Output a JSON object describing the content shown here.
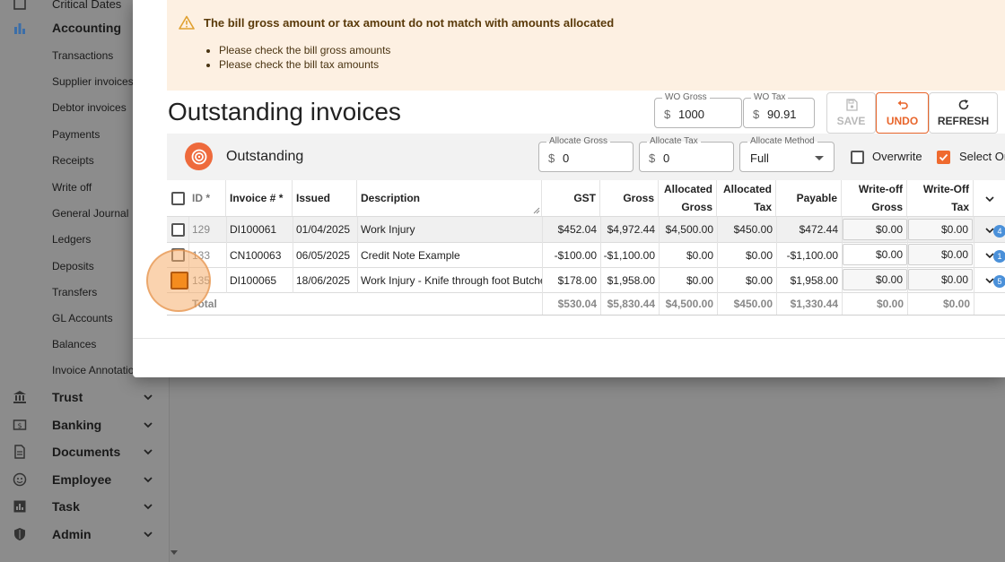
{
  "sidebar": {
    "critical_dates": "Critical Dates",
    "accounting": "Accounting",
    "sub_items": [
      "Transactions",
      "Supplier invoices",
      "Debtor invoices",
      "Payments",
      "Receipts",
      "Write off",
      "General Journal",
      "Ledgers",
      "Deposits",
      "Transfers",
      "GL Accounts",
      "Balances",
      "Invoice Annotations"
    ],
    "main_items": [
      {
        "label": "Trust",
        "icon": "bank-icon"
      },
      {
        "label": "Banking",
        "icon": "banking-icon"
      },
      {
        "label": "Documents",
        "icon": "document-icon"
      },
      {
        "label": "Employee",
        "icon": "employee-icon"
      },
      {
        "label": "Task",
        "icon": "task-icon"
      },
      {
        "label": "Admin",
        "icon": "shield-icon"
      }
    ]
  },
  "alert": {
    "title": "The bill gross amount or tax amount do not match with amounts allocated",
    "items": [
      "Please check the bill gross amounts",
      "Please check the bill tax amounts"
    ]
  },
  "page": {
    "title": "Outstanding invoices"
  },
  "wo_fields": {
    "gross": {
      "label": "WO Gross",
      "prefix": "$",
      "value": "1000"
    },
    "tax": {
      "label": "WO Tax",
      "prefix": "$",
      "value": "90.91"
    }
  },
  "actions": {
    "save": "SAVE",
    "undo": "UNDO",
    "refresh": "REFRESH"
  },
  "panel": {
    "title": "Outstanding",
    "allocate_gross": {
      "label": "Allocate Gross",
      "prefix": "$",
      "value": "0"
    },
    "allocate_tax": {
      "label": "Allocate Tax",
      "prefix": "$",
      "value": "0"
    },
    "allocate_method": {
      "label": "Allocate Method",
      "value": "Full"
    },
    "overwrite_label": "Overwrite",
    "select_label": "Select Or"
  },
  "table": {
    "headers": {
      "id": "ID *",
      "invoice": "Invoice # *",
      "issued": "Issued",
      "description": "Description",
      "gst": "GST",
      "gross": "Gross",
      "allocated_gross": "Allocated Gross",
      "allocated_tax": "Allocated Tax",
      "payable": "Payable",
      "wo_gross": "Write-off Gross",
      "wo_tax": "Write-Off Tax"
    },
    "rows": [
      {
        "id": "129",
        "invoice": "DI100061",
        "issued": "01/04/2025",
        "description": "Work Injury",
        "gst": "$452.04",
        "gross": "$4,972.44",
        "allocated_gross": "$4,500.00",
        "allocated_tax": "$450.00",
        "payable": "$472.44",
        "wo_gross": "$0.00",
        "wo_tax": "$0.00",
        "badge": "4"
      },
      {
        "id": "133",
        "invoice": "CN100063",
        "issued": "06/05/2025",
        "description": "Credit Note Example",
        "gst": "-$100.00",
        "gross": "-$1,100.00",
        "allocated_gross": "$0.00",
        "allocated_tax": "$0.00",
        "payable": "-$1,100.00",
        "wo_gross": "$0.00",
        "wo_tax": "$0.00",
        "badge": "1"
      },
      {
        "id": "135",
        "invoice": "DI100065",
        "issued": "18/06/2025",
        "description": "Work Injury - Knife through foot Butcher",
        "gst": "$178.00",
        "gross": "$1,958.00",
        "allocated_gross": "$0.00",
        "allocated_tax": "$0.00",
        "payable": "$1,958.00",
        "wo_gross": "$0.00",
        "wo_tax": "$0.00",
        "badge": "5"
      }
    ],
    "totals": {
      "label": "Total",
      "gst": "$530.04",
      "gross": "$5,830.44",
      "allocated_gross": "$4,500.00",
      "allocated_tax": "$450.00",
      "payable": "$1,330.44",
      "wo_gross": "$0.00",
      "wo_tax": "$0.00"
    }
  },
  "colors": {
    "accent": "#ef6a2e",
    "alert_bg": "#fdf0e2",
    "badge": "#4a90d9"
  }
}
